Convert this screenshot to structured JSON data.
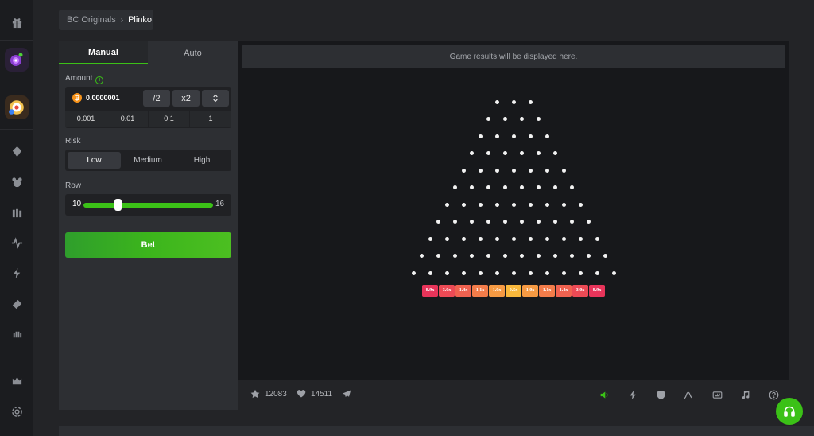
{
  "sidebar": {
    "icons": [
      "gift-icon",
      "tag-icon",
      "casino-chip-icon",
      "cards-icon",
      "pulse-icon",
      "lightning-icon",
      "ticket-icon",
      "hand-icon",
      "vip-crown-icon",
      "settings-icon"
    ]
  },
  "breadcrumb": {
    "parent": "BC Originals",
    "current": "Plinko"
  },
  "panel": {
    "tabs": [
      {
        "label": "Manual",
        "active": true
      },
      {
        "label": "Auto",
        "active": false
      }
    ],
    "amount": {
      "label": "Amount",
      "value": "0.0000001",
      "currency_icon": "bitcoin-icon",
      "half_label": "/2",
      "double_label": "x2",
      "quick": [
        "0.001",
        "0.01",
        "0.1",
        "1"
      ]
    },
    "risk": {
      "label": "Risk",
      "options": [
        "Low",
        "Medium",
        "High"
      ],
      "selected": "Low"
    },
    "row": {
      "label": "Row",
      "min": "10",
      "max": "16",
      "value": 11
    },
    "bet_label": "Bet"
  },
  "game": {
    "results_text": "Game results will be displayed here.",
    "rows": 11,
    "multipliers": [
      "8.9x",
      "3.0x",
      "1.4x",
      "1.1x",
      "1.0x",
      "0.5x",
      "1.0x",
      "1.1x",
      "1.4x",
      "3.0x",
      "8.9x"
    ],
    "multiplier_colors": [
      "#e8345a",
      "#ec4a55",
      "#f06250",
      "#f37c4a",
      "#f69a43",
      "#f9b83c",
      "#f69a43",
      "#f37c4a",
      "#f06250",
      "#ec4a55",
      "#e8345a"
    ]
  },
  "footer": {
    "likes": "12083",
    "favorites": "14511",
    "icons": [
      "sound-icon",
      "turbo-icon",
      "fairness-icon",
      "stats-icon",
      "hotkeys-icon",
      "music-icon",
      "help-icon"
    ]
  },
  "colors": {
    "accent": "#3bc117",
    "background": "#232427",
    "panel": "#2d2f33"
  }
}
